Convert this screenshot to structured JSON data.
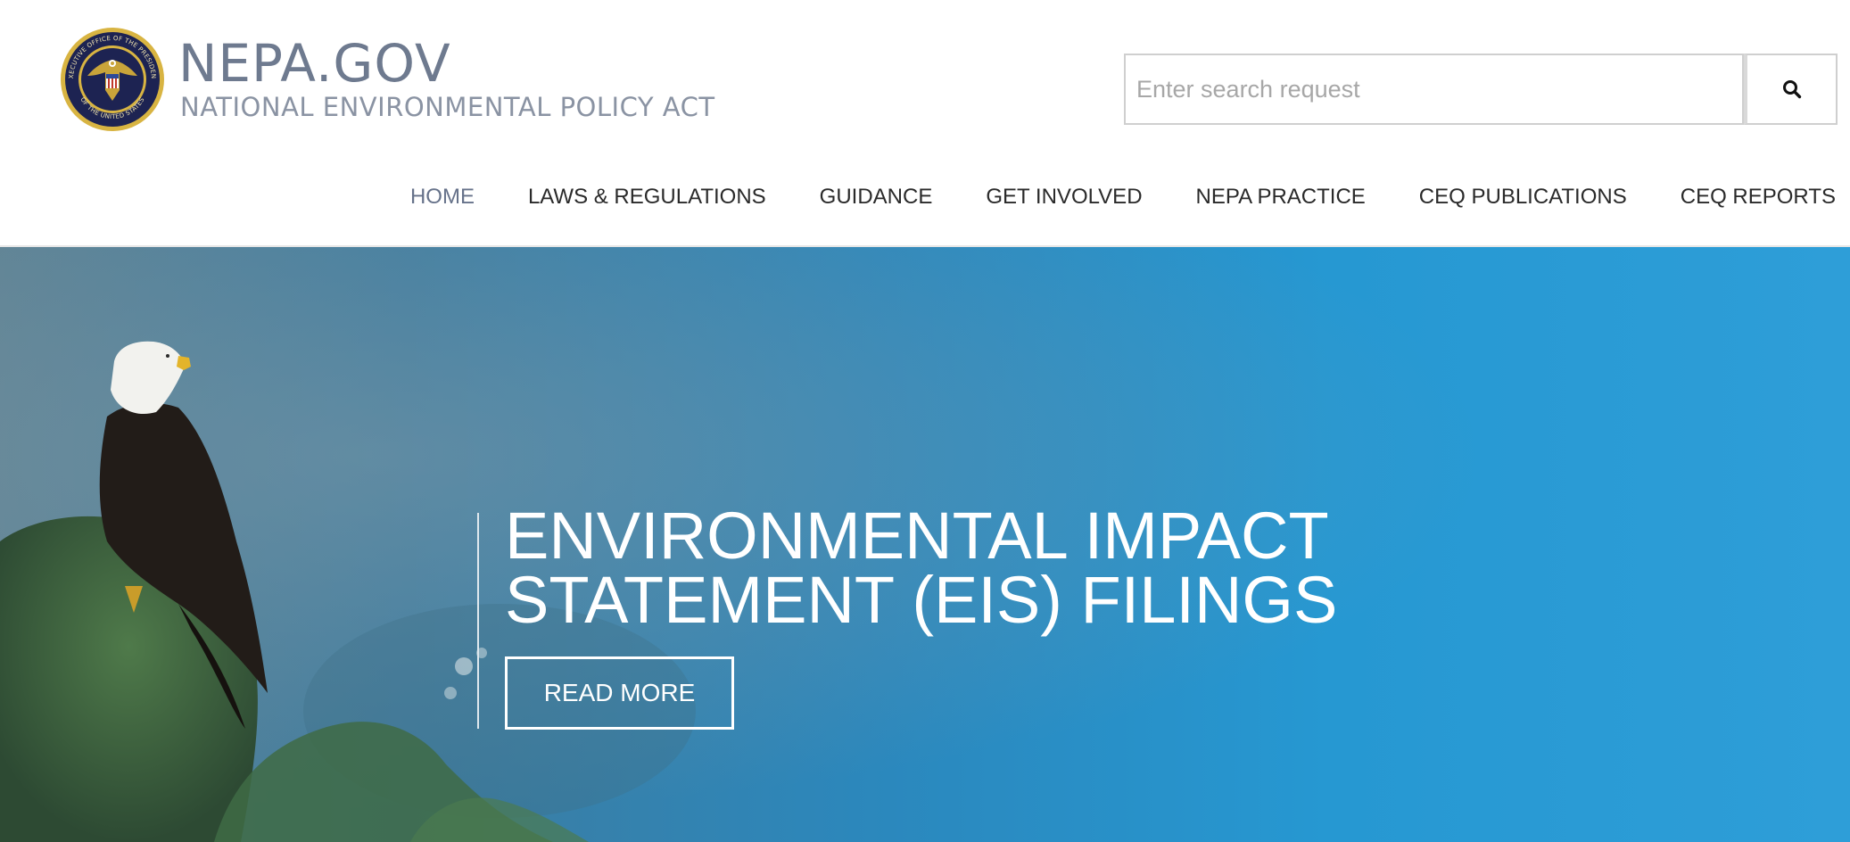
{
  "header": {
    "seal_icon": "presidential-seal-icon",
    "seal_text_top": "EXECUTIVE OFFICE OF THE PRESIDENT",
    "seal_text_bottom": "OF THE UNITED STATES",
    "title": "NEPA.GOV",
    "subtitle": "NATIONAL ENVIRONMENTAL POLICY ACT"
  },
  "search": {
    "placeholder": "Enter search request",
    "value": "",
    "button_icon": "search-icon"
  },
  "nav": {
    "items": [
      {
        "label": "HOME",
        "active": true
      },
      {
        "label": "LAWS & REGULATIONS",
        "active": false
      },
      {
        "label": "GUIDANCE",
        "active": false
      },
      {
        "label": "GET INVOLVED",
        "active": false
      },
      {
        "label": "NEPA PRACTICE",
        "active": false
      },
      {
        "label": "CEQ PUBLICATIONS",
        "active": false
      },
      {
        "label": "CEQ REPORTS",
        "active": false
      }
    ]
  },
  "hero": {
    "title_line1": "ENVIRONMENTAL IMPACT",
    "title_line2": "STATEMENT (EIS) FILINGS",
    "button_label": "READ MORE",
    "image": "bald-eagle-on-mossy-rock-photo"
  },
  "colors": {
    "brand": "#6e7a8f",
    "nav_text": "#2a2a2a",
    "nav_active": "#66728a",
    "hero_blue": "#2698d2",
    "seal_gold": "#d8b442",
    "seal_navy": "#1d2352"
  }
}
